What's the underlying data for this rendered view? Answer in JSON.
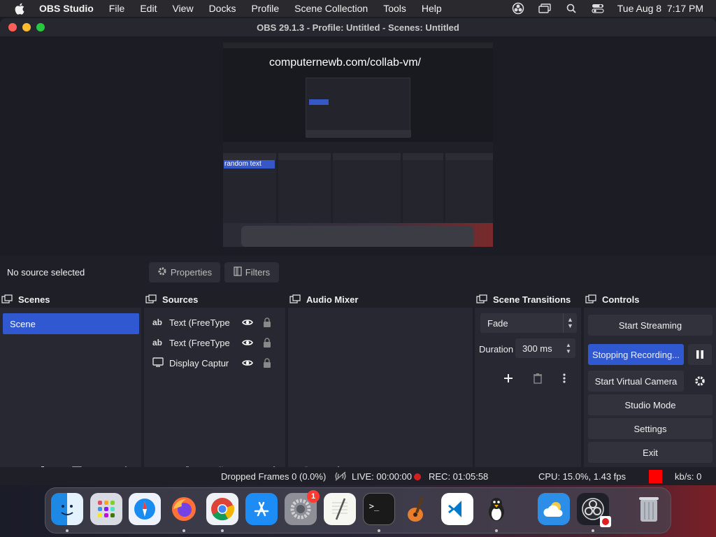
{
  "menubar": {
    "app_name": "OBS Studio",
    "items": [
      "File",
      "Edit",
      "View",
      "Docks",
      "Profile",
      "Scene Collection",
      "Tools",
      "Help"
    ],
    "clock": "Tue Aug 8  7:17 PM"
  },
  "window": {
    "title": "OBS 29.1.3 - Profile: Untitled - Scenes: Untitled"
  },
  "preview": {
    "overlay_text": "computernewb.com/collab-vm/",
    "selected_text": "random text"
  },
  "source_bar": {
    "no_source": "No source selected",
    "properties_label": "Properties",
    "filters_label": "Filters"
  },
  "scenes": {
    "title": "Scenes",
    "items": [
      "Scene"
    ]
  },
  "sources": {
    "title": "Sources",
    "items": [
      {
        "type": "ab",
        "name": "Text (FreeType"
      },
      {
        "type": "ab",
        "name": "Text (FreeType"
      },
      {
        "type": "monitor",
        "name": "Display Captur"
      }
    ]
  },
  "audio_mixer": {
    "title": "Audio Mixer"
  },
  "scene_transitions": {
    "title": "Scene Transitions",
    "transition": "Fade",
    "duration_label": "Duration",
    "duration_value": "300 ms"
  },
  "controls": {
    "title": "Controls",
    "start_streaming": "Start Streaming",
    "stopping_recording": "Stopping Recording...",
    "start_virtual_camera": "Start Virtual Camera",
    "studio_mode": "Studio Mode",
    "settings": "Settings",
    "exit": "Exit"
  },
  "status": {
    "dropped_frames": "Dropped Frames 0 (0.0%)",
    "live": "LIVE: 00:00:00",
    "rec": "REC: 01:05:58",
    "cpu": "CPU: 15.0%, 1.43 fps",
    "kbs": "kb/s: 0"
  },
  "dock": {
    "apps": [
      "finder-icon",
      "launchpad-icon",
      "safari-icon",
      "firefox-icon",
      "chrome-icon",
      "app-store-icon",
      "system-settings-icon",
      "textedit-icon",
      "terminal-icon",
      "garageband-icon",
      "vscode-icon",
      "gimp-icon",
      "weather-icon",
      "obs-icon",
      "trash-icon"
    ],
    "settings_badge": "1"
  },
  "colors": {
    "accent": "#3058d0",
    "record": "#d42020",
    "panel": "#272831"
  }
}
